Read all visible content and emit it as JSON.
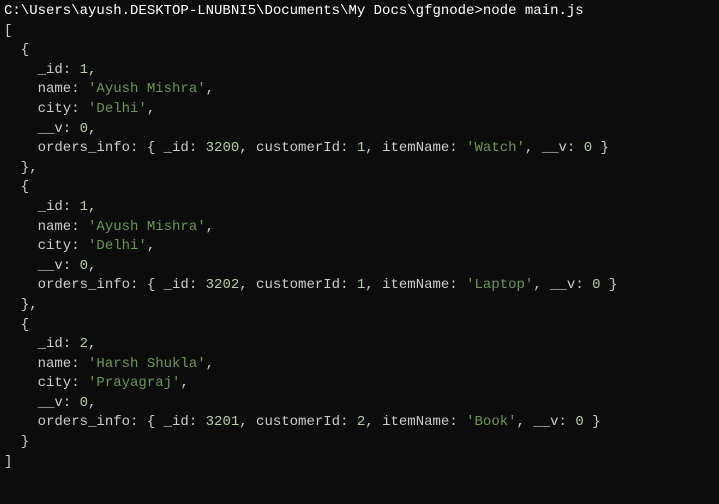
{
  "prompt": "C:\\Users\\ayush.DESKTOP-LNUBNI5\\Documents\\My Docs\\gfgnode>node main.js",
  "open_bracket": "[",
  "close_bracket": "]",
  "records": [
    {
      "open": "  {",
      "id_key": "    _id: ",
      "id_val": "1",
      "id_end": ",",
      "name_key": "    name: ",
      "name_val": "'Ayush Mishra'",
      "name_end": ",",
      "city_key": "    city: ",
      "city_val": "'Delhi'",
      "city_end": ",",
      "v_key": "    __v: ",
      "v_val": "0",
      "v_end": ",",
      "oi_prefix": "    orders_info: { _id: ",
      "oi_id": "3200",
      "oi_mid1": ", customerId: ",
      "oi_cust": "1",
      "oi_mid2": ", itemName: ",
      "oi_item": "'Watch'",
      "oi_mid3": ", __v: ",
      "oi_v": "0",
      "oi_end": " }",
      "close": "  },"
    },
    {
      "open": "  {",
      "id_key": "    _id: ",
      "id_val": "1",
      "id_end": ",",
      "name_key": "    name: ",
      "name_val": "'Ayush Mishra'",
      "name_end": ",",
      "city_key": "    city: ",
      "city_val": "'Delhi'",
      "city_end": ",",
      "v_key": "    __v: ",
      "v_val": "0",
      "v_end": ",",
      "oi_prefix": "    orders_info: { _id: ",
      "oi_id": "3202",
      "oi_mid1": ", customerId: ",
      "oi_cust": "1",
      "oi_mid2": ", itemName: ",
      "oi_item": "'Laptop'",
      "oi_mid3": ", __v: ",
      "oi_v": "0",
      "oi_end": " }",
      "close": "  },"
    },
    {
      "open": "  {",
      "id_key": "    _id: ",
      "id_val": "2",
      "id_end": ",",
      "name_key": "    name: ",
      "name_val": "'Harsh Shukla'",
      "name_end": ",",
      "city_key": "    city: ",
      "city_val": "'Prayagraj'",
      "city_end": ",",
      "v_key": "    __v: ",
      "v_val": "0",
      "v_end": ",",
      "oi_prefix": "    orders_info: { _id: ",
      "oi_id": "3201",
      "oi_mid1": ", customerId: ",
      "oi_cust": "2",
      "oi_mid2": ", itemName: ",
      "oi_item": "'Book'",
      "oi_mid3": ", __v: ",
      "oi_v": "0",
      "oi_end": " }",
      "close": "  }"
    }
  ]
}
